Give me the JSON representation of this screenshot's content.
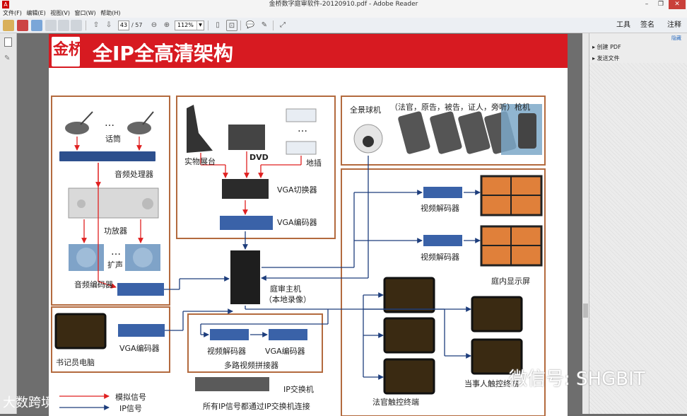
{
  "titlebar": {
    "title": "金桥数字庭审软件-20120910.pdf - Adobe Reader",
    "app_icon": "A",
    "minimize": "–",
    "restore": "❐",
    "close": "✕"
  },
  "menu": [
    "文件(F)",
    "编辑(E)",
    "视图(V)",
    "窗口(W)",
    "帮助(H)"
  ],
  "toolbar": {
    "page_current": "43",
    "page_total": "/ 57",
    "zoom": "112%",
    "tools": "工具",
    "sign": "签名",
    "comment": "注释"
  },
  "right_panel": {
    "hide": "隐藏",
    "items": [
      "▸ 创建 PDF",
      "▸ 发送文件"
    ]
  },
  "slide": {
    "logo_text": "SHGBIT",
    "logo_glyph": "金桥",
    "title": "全IP全高清架构",
    "labels": {
      "mic": "话筒",
      "dots": "…",
      "audio_proc": "音频处理器",
      "amp": "功放器",
      "speaker": "扩声",
      "audio_enc": "音频编码器",
      "doc_cam": "实物展台",
      "dvd": "DVD",
      "plug": "地插",
      "vga_switch": "VGA切换器",
      "vga_enc_top": "VGA编码器",
      "pano": "全景球机",
      "roles": "（法官，原告，被告，证人，旁听）枪机",
      "dec1": "视频解码器",
      "dec2": "视频解码器",
      "court_display": "庭内显示屏",
      "host": "庭审主机",
      "host_sub": "（本地录像）",
      "clerk_pc": "书记员电脑",
      "clerk_enc": "VGA编码器",
      "mv_dec": "视频解码器",
      "mv_enc": "VGA编码器",
      "mv_title": "多路视频拼接器",
      "ip_switch": "IP交换机",
      "ip_note": "所有IP信号都通过IP交换机连接",
      "legend_analog": "模拟信号",
      "legend_ip": "IP信号",
      "judge_terminal": "法官触控终端",
      "party_terminal": "当事人触控终端"
    }
  },
  "watermark": {
    "left_logo": "大数跨境",
    "right_text": "微信号: SHGBIT"
  },
  "colors": {
    "brand_red": "#d71a21",
    "frame_brown": "#b36a3e",
    "analog_red": "#e02020",
    "ip_blue": "#1d3d7c",
    "screen_orange": "#e0803a"
  }
}
